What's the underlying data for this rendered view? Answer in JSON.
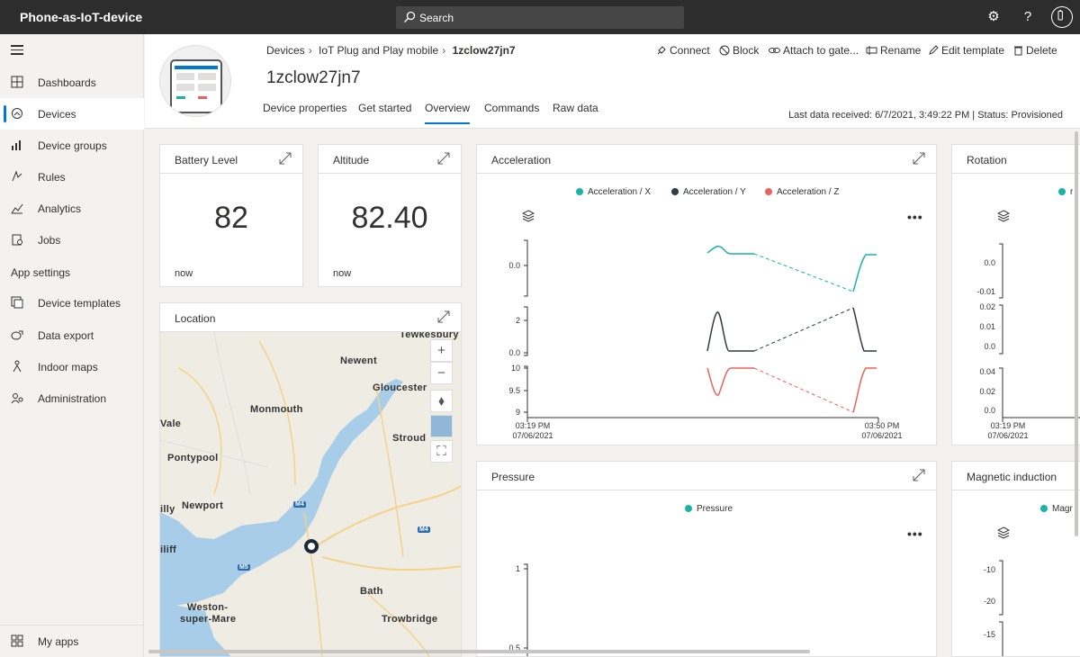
{
  "app": {
    "name": "Phone-as-IoT-device"
  },
  "search": {
    "placeholder": "Search"
  },
  "sidebar": {
    "items": [
      {
        "label": "Dashboards"
      },
      {
        "label": "Devices"
      },
      {
        "label": "Device groups"
      },
      {
        "label": "Rules"
      },
      {
        "label": "Analytics"
      },
      {
        "label": "Jobs"
      }
    ],
    "section_header": "App settings",
    "settings_items": [
      {
        "label": "Device templates"
      },
      {
        "label": "Data export"
      },
      {
        "label": "Indoor maps"
      },
      {
        "label": "Administration"
      }
    ],
    "bottom": {
      "label": "My apps"
    }
  },
  "breadcrumb": {
    "root": "Devices",
    "template": "IoT Plug and Play mobile",
    "device": "1zclow27jn7"
  },
  "device": {
    "title": "1zclow27jn7"
  },
  "actions": {
    "connect": "Connect",
    "block": "Block",
    "attach": "Attach to gate...",
    "rename": "Rename",
    "edit_template": "Edit template",
    "delete": "Delete"
  },
  "tabs": [
    "Device properties",
    "Get started",
    "Overview",
    "Commands",
    "Raw data"
  ],
  "last_data": "Last data received: 6/7/2021, 3:49:22 PM  |  Status: Provisioned",
  "tiles": {
    "battery": {
      "title": "Battery Level",
      "value": "82",
      "foot": "now"
    },
    "altitude": {
      "title": "Altitude",
      "value": "82.40",
      "foot": "now"
    },
    "location": {
      "title": "Location"
    },
    "acceleration": {
      "title": "Acceleration",
      "legend": [
        "Acceleration / X",
        "Acceleration / Y",
        "Acceleration / Z"
      ],
      "y_ticks_x": [
        "0.0"
      ],
      "y_ticks_y": [
        "2",
        "0.0"
      ],
      "y_ticks_z": [
        "10",
        "9.5",
        "9"
      ],
      "x_start": [
        "03:19 PM",
        "07/06/2021"
      ],
      "x_end": [
        "03:50 PM",
        "07/06/2021"
      ]
    },
    "rotation": {
      "title": "Rotation",
      "legend_partial": "r",
      "y_ticks_1": [
        "0.0",
        "-0.01"
      ],
      "y_ticks_2": [
        "0.02",
        "0.01",
        "0.0"
      ],
      "y_ticks_3": [
        "0.04",
        "0.02",
        "0.0"
      ],
      "x_start": [
        "03:19 PM",
        "07/06/2021"
      ]
    },
    "pressure": {
      "title": "Pressure",
      "legend": "Pressure",
      "y_ticks": [
        "1",
        "0.5"
      ]
    },
    "magnetic": {
      "title": "Magnetic induction",
      "legend": "Magr",
      "y_ticks": [
        "-10",
        "-20",
        "-15"
      ]
    }
  },
  "map_labels": {
    "tewkesbury": "Tewkesbury",
    "newent": "Newent",
    "gloucester": "Gloucester",
    "monmouth": "Monmouth",
    "vale": "Vale",
    "stroud": "Stroud",
    "pontypool": "Pontypool",
    "newport": "Newport",
    "illy": "illy",
    "iliff": "iliff",
    "bath": "Bath",
    "weston1": "Weston-",
    "weston2": "super-Mare",
    "trowbridge": "Trowbridge",
    "m4a": "M4",
    "m4b": "M4",
    "m5": "M5"
  },
  "more_label": "•••",
  "colors": {
    "accent": "#0078d4",
    "series_x": "#1ab3a6",
    "series_y": "#2d3c46",
    "series_z": "#e8645a",
    "topbar": "#2d2d2d"
  },
  "chart_data": [
    {
      "type": "line",
      "title": "Acceleration",
      "x": [
        "03:19 PM 07/06/2021",
        "03:50 PM 07/06/2021"
      ],
      "series": [
        {
          "name": "Acceleration / X",
          "note_values": [
            0.005,
            0.008,
            0.005,
            0.005,
            -0.02,
            0.0,
            0.0
          ]
        },
        {
          "name": "Acceleration / Y",
          "note_values": [
            0.0,
            2.6,
            0.0,
            0.0,
            2.9,
            0.0,
            0.0
          ]
        },
        {
          "name": "Acceleration / Z",
          "note_values": [
            9.99,
            9.6,
            9.99,
            9.99,
            9.0,
            9.99,
            9.99
          ]
        }
      ]
    },
    {
      "type": "line",
      "title": "Pressure",
      "series": [
        {
          "name": "Pressure",
          "note_values": []
        }
      ],
      "ylim": [
        0.5,
        1
      ]
    }
  ]
}
